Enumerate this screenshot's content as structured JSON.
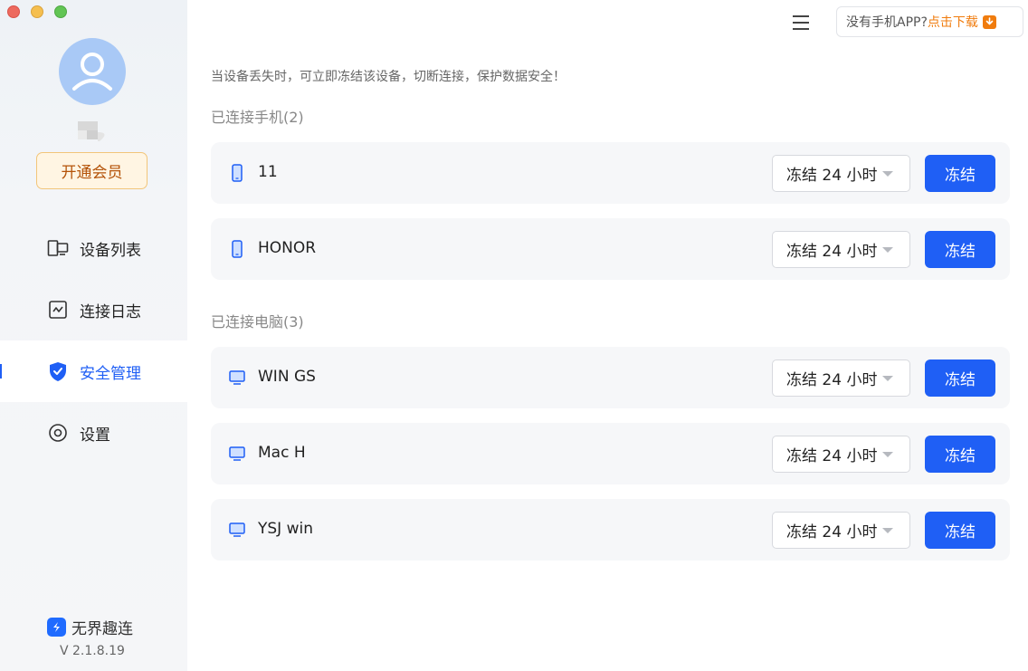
{
  "sidebar": {
    "vip_button": "开通会员",
    "nav": [
      {
        "label": "设备列表",
        "icon": "device-list-icon"
      },
      {
        "label": "连接日志",
        "icon": "connection-log-icon"
      },
      {
        "label": "安全管理",
        "icon": "security-shield-icon",
        "active": true
      },
      {
        "label": "设置",
        "icon": "settings-icon"
      }
    ],
    "brand_name": "无界趣连",
    "version": "V 2.1.8.19"
  },
  "header": {
    "download_prompt": "没有手机APP?",
    "download_link": "点击下载"
  },
  "main": {
    "description": "当设备丢失时，可立即冻结该设备，切断连接，保护数据安全！",
    "phones_section": {
      "title": "已连接手机(2)",
      "devices": [
        {
          "name": "11",
          "duration": "冻结 24 小时",
          "action": "冻结"
        },
        {
          "name": "HONOR",
          "duration": "冻结 24 小时",
          "action": "冻结"
        }
      ]
    },
    "computers_section": {
      "title": "已连接电脑(3)",
      "devices": [
        {
          "name": "WIN GS",
          "duration": "冻结 24 小时",
          "action": "冻结"
        },
        {
          "name": "Mac H",
          "duration": "冻结 24 小时",
          "action": "冻结"
        },
        {
          "name": "YSJ win",
          "duration": "冻结 24 小时",
          "action": "冻结"
        }
      ]
    }
  },
  "colors": {
    "accent": "#1f5ff5",
    "vip_text": "#b45309",
    "download_orange": "#f07c0e"
  }
}
